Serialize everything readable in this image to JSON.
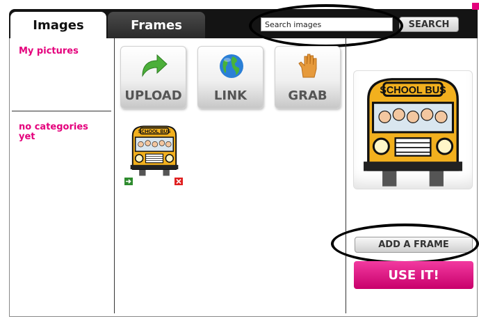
{
  "tabs": [
    {
      "label": "Images",
      "active": true
    },
    {
      "label": "Frames",
      "active": false
    }
  ],
  "search": {
    "value": "Search images",
    "button_label": "SEARCH"
  },
  "sidebar": {
    "categories": [
      {
        "label": "My pictures"
      },
      {
        "label": "no categories yet"
      }
    ]
  },
  "tools": [
    {
      "label": "UPLOAD",
      "icon": "green-arrow-icon"
    },
    {
      "label": "LINK",
      "icon": "globe-icon"
    },
    {
      "label": "GRAB",
      "icon": "hand-icon"
    }
  ],
  "thumbnails": [
    {
      "image": "school-bus-image",
      "sign_text": "SCHOOL BUS"
    }
  ],
  "preview": {
    "image": "school-bus-image",
    "sign_text": "SCHOOL BUS"
  },
  "actions": {
    "add_frame_label": "ADD A FRAME",
    "use_label": "USE IT!"
  },
  "colors": {
    "accent": "#e4007c",
    "topbar": "#141414",
    "use_button": "#d9117f"
  }
}
